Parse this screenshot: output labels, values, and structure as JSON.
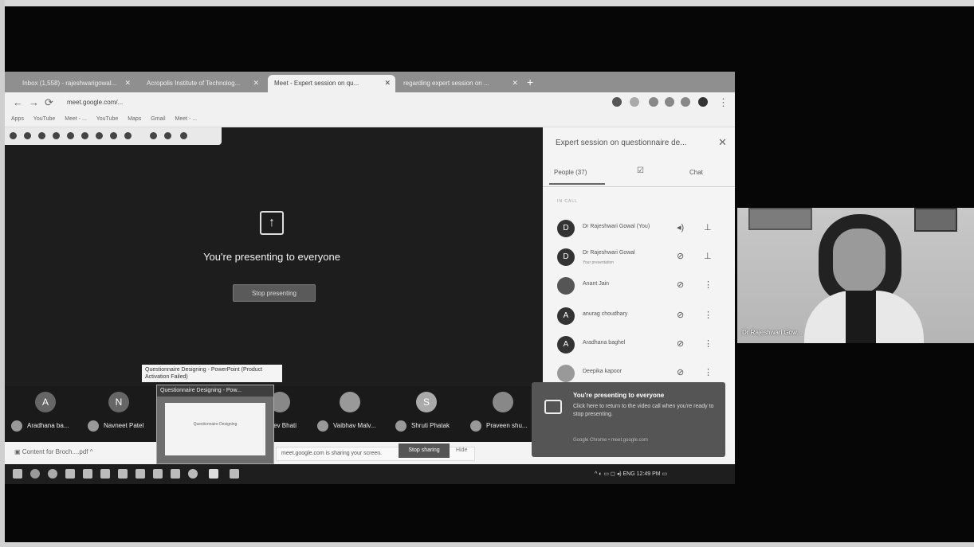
{
  "browser": {
    "tabs": [
      {
        "label": "Inbox (1,558) - rajeshwarigowal...",
        "active": false
      },
      {
        "label": "Acropolis Institute of Technolog...",
        "active": false
      },
      {
        "label": "Meet - Expert session on qu...",
        "active": true
      },
      {
        "label": "regarding expert session on ...",
        "active": false
      }
    ],
    "url": "meet.google.com/...",
    "bookmarks": [
      "Apps",
      "YouTube",
      "Meet - ...",
      "YouTube",
      "Maps",
      "Gmail",
      "Meet - ..."
    ]
  },
  "meet": {
    "presenting_text": "You're presenting to everyone",
    "stop_presenting": "Stop presenting",
    "preview_tooltip": "Questionnaire Designing - PowerPoint (Product Activation Failed)",
    "preview_title": "Questionnaire Designing - Pow...",
    "preview_slide_text": "Questionnaire Designing",
    "participants": [
      {
        "initial": "A",
        "name": "Aradhana ba..."
      },
      {
        "initial": "N",
        "name": "Navneet Patel"
      },
      {
        "initial": "",
        "name": "...dev Bhati"
      },
      {
        "initial": "",
        "name": "Vaibhav Malv..."
      },
      {
        "initial": "S",
        "name": "Shruti Phatak"
      },
      {
        "initial": "",
        "name": "Praveen shu..."
      }
    ]
  },
  "side_panel": {
    "title": "Expert session on questionnaire de...",
    "people_tab": "People (37)",
    "chat_tab": "Chat",
    "section": "IN CALL",
    "people": [
      {
        "initial": "D",
        "name": "Dr Rajeshwari Gowal (You)",
        "sub": ""
      },
      {
        "initial": "D",
        "name": "Dr Rajeshwari Gowal",
        "sub": "Your presentation"
      },
      {
        "initial": "",
        "name": "Anant Jain",
        "sub": ""
      },
      {
        "initial": "A",
        "name": "anurag choudhary",
        "sub": ""
      },
      {
        "initial": "A",
        "name": "Aradhana baghel",
        "sub": ""
      },
      {
        "initial": "",
        "name": "Deepika kapoor",
        "sub": ""
      }
    ]
  },
  "downloads": {
    "file": "Content for Broch....pdf",
    "sharing_text": "meet.google.com is sharing your screen.",
    "stop_sharing": "Stop sharing",
    "hide": "Hide"
  },
  "toast": {
    "title": "You're presenting to everyone",
    "body": "Click here to return to the video call when you're ready to stop presenting.",
    "footer": "Google Chrome • meet.google.com"
  },
  "taskbar": {
    "tray": "ENG 12:49 PM"
  },
  "video": {
    "name": "Dr Rajeshwari Gow..."
  }
}
